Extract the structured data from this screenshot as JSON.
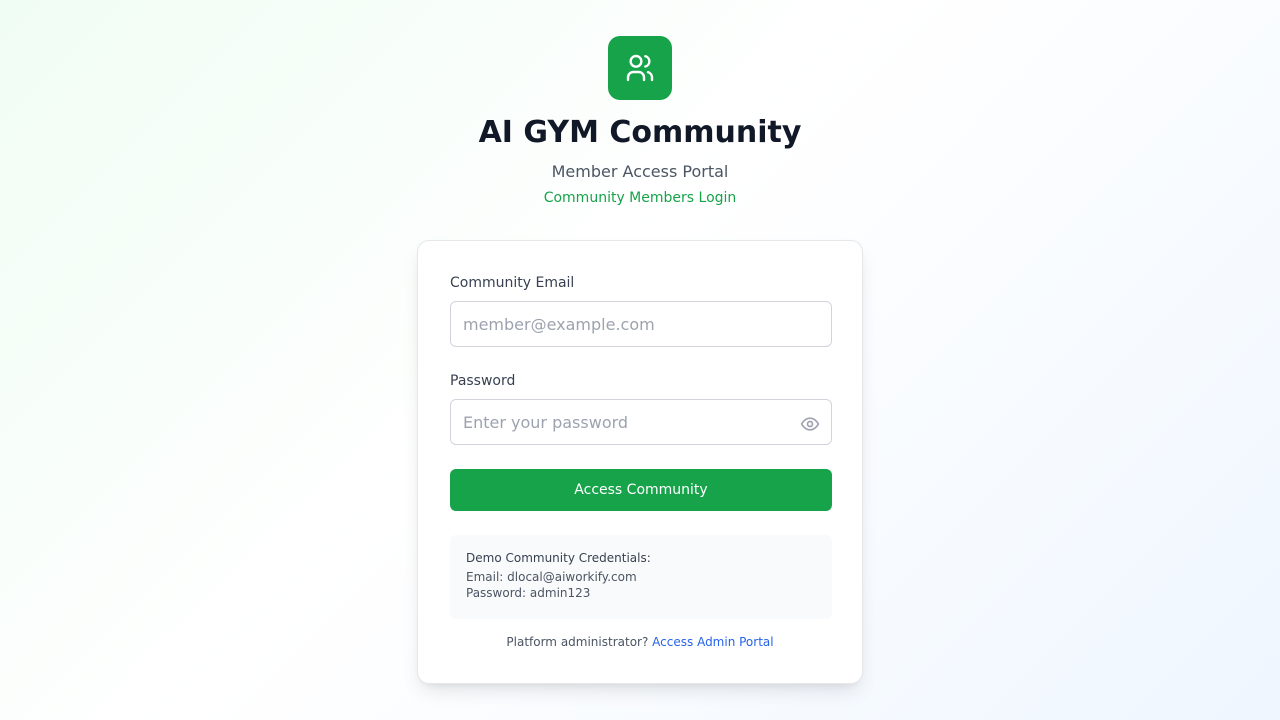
{
  "header": {
    "logo_icon": "users-icon",
    "title": "AI GYM Community",
    "subtitle": "Member Access Portal",
    "tagline": "Community Members Login"
  },
  "form": {
    "email_label": "Community Email",
    "email_placeholder": "member@example.com",
    "email_value": "",
    "password_label": "Password",
    "password_placeholder": "Enter your password",
    "password_value": "",
    "toggle_icon": "eye-icon",
    "submit_label": "Access Community"
  },
  "demo": {
    "title": "Demo Community Credentials:",
    "email_line": "Email: dlocal@aiworkify.com",
    "password_line": "Password: admin123"
  },
  "footer": {
    "prompt": "Platform administrator?",
    "link_label": "Access Admin Portal"
  },
  "colors": {
    "brand": "#16a34a",
    "link": "#2563eb"
  }
}
